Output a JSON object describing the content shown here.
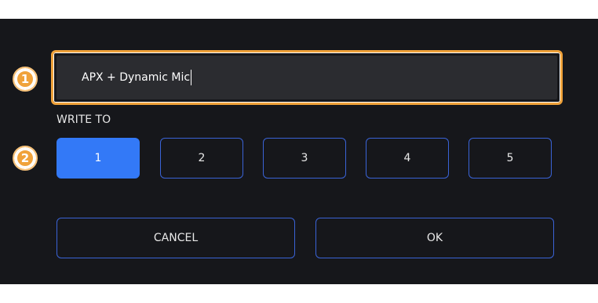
{
  "callouts": {
    "one": "1",
    "two": "2"
  },
  "name_field": {
    "value": "APX + Dynamic Mic"
  },
  "write_to": {
    "label": "WRITE TO",
    "slots": [
      {
        "label": "1",
        "selected": true
      },
      {
        "label": "2",
        "selected": false
      },
      {
        "label": "3",
        "selected": false
      },
      {
        "label": "4",
        "selected": false
      },
      {
        "label": "5",
        "selected": false
      }
    ]
  },
  "actions": {
    "cancel": "CANCEL",
    "ok": "OK"
  },
  "colors": {
    "accent_blue": "#3379f7",
    "outline_blue": "#3a63d6",
    "callout_orange": "#f0a23a",
    "background": "#16171b"
  }
}
